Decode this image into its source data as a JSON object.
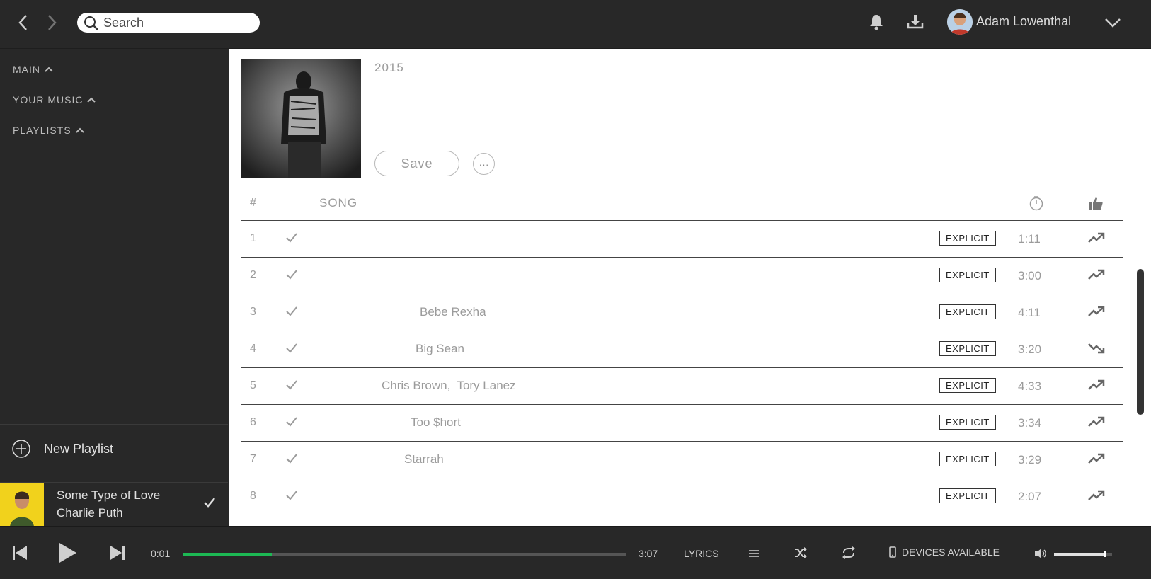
{
  "header": {
    "search_placeholder": "Search",
    "user_name": "Adam Lowenthal"
  },
  "sidebar": {
    "sections": [
      {
        "label": "MAIN"
      },
      {
        "label": "YOUR MUSIC"
      },
      {
        "label": "PLAYLISTS"
      }
    ],
    "new_playlist_label": "New Playlist",
    "now_playing": {
      "title": "Some Type of Love",
      "artist": "Charlie Puth"
    }
  },
  "album": {
    "year": "2015",
    "save_label": "Save",
    "more_label": "···"
  },
  "table": {
    "col_num": "#",
    "col_song": "SONG",
    "tracks": [
      {
        "num": "1",
        "artist": "",
        "explicit": "EXPLICIT",
        "duration": "1:11",
        "trend": "up"
      },
      {
        "num": "2",
        "artist": "",
        "explicit": "EXPLICIT",
        "duration": "3:00",
        "trend": "up"
      },
      {
        "num": "3",
        "artist": "Bebe Rexha",
        "explicit": "EXPLICIT",
        "duration": "4:11",
        "trend": "up"
      },
      {
        "num": "4",
        "artist": "Big Sean",
        "explicit": "EXPLICIT",
        "duration": "3:20",
        "trend": "down"
      },
      {
        "num": "5",
        "artist": "Chris Brown,  Tory Lanez",
        "explicit": "EXPLICIT",
        "duration": "4:33",
        "trend": "up"
      },
      {
        "num": "6",
        "artist": "Too $hort",
        "explicit": "EXPLICIT",
        "duration": "3:34",
        "trend": "up"
      },
      {
        "num": "7",
        "artist": "Starrah",
        "explicit": "EXPLICIT",
        "duration": "3:29",
        "trend": "up"
      },
      {
        "num": "8",
        "artist": "",
        "explicit": "EXPLICIT",
        "duration": "2:07",
        "trend": "up"
      }
    ]
  },
  "player": {
    "current_time": "0:01",
    "total_time": "3:07",
    "progress_fraction": 0.2,
    "lyrics_label": "LYRICS",
    "devices_label": "DEVICES AVAILABLE",
    "volume_fraction": 0.88,
    "accent_color": "#1db954"
  }
}
